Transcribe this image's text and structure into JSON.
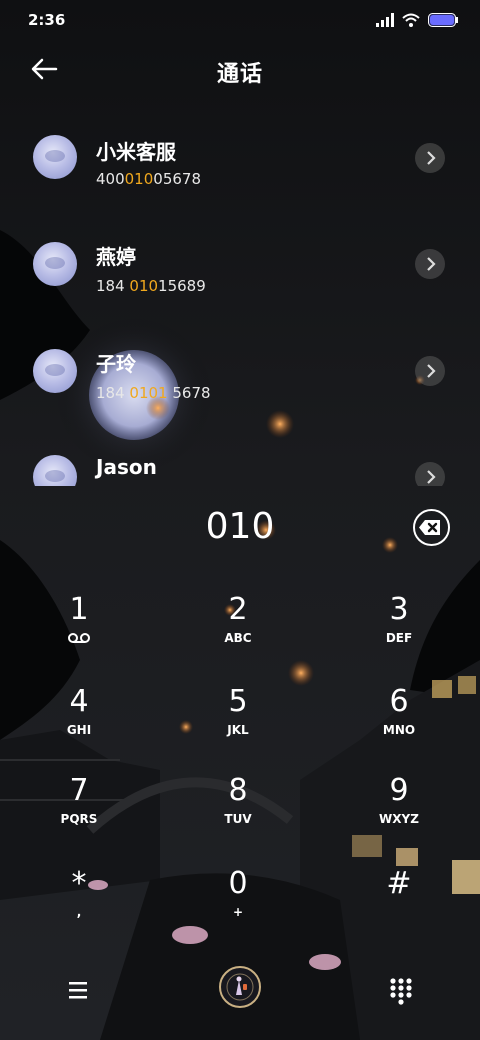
{
  "status_bar": {
    "time": "2:36"
  },
  "header": {
    "title": "通话"
  },
  "contacts": [
    {
      "name": "小米客服",
      "number": {
        "pre": "400",
        "hl": "010",
        "post": "05678"
      }
    },
    {
      "name": "燕婷",
      "number": {
        "pre": "184 ",
        "hl": "010",
        "post": "15689"
      }
    },
    {
      "name": "子玲",
      "number": {
        "pre": "184 ",
        "hl": "0101",
        "post": " 5678"
      }
    },
    {
      "name": "Jason",
      "number": {
        "pre": "",
        "hl": "",
        "post": ""
      }
    }
  ],
  "dialer": {
    "entered": "010",
    "keys": [
      {
        "digit": "1",
        "letters": ""
      },
      {
        "digit": "2",
        "letters": "ABC"
      },
      {
        "digit": "3",
        "letters": "DEF"
      },
      {
        "digit": "4",
        "letters": "GHI"
      },
      {
        "digit": "5",
        "letters": "JKL"
      },
      {
        "digit": "6",
        "letters": "MNO"
      },
      {
        "digit": "7",
        "letters": "PQRS"
      },
      {
        "digit": "8",
        "letters": "TUV"
      },
      {
        "digit": "9",
        "letters": "WXYZ"
      },
      {
        "digit": "*",
        "letters": ","
      },
      {
        "digit": "0",
        "letters": "+"
      },
      {
        "digit": "#",
        "letters": ""
      }
    ]
  },
  "icons": {
    "back": "back-arrow-icon",
    "voicemail": "voicemail-icon",
    "backspace": "backspace-icon",
    "menu": "menu-icon",
    "keypad": "keypad-icon"
  },
  "colors": {
    "highlight": "#f0a81e",
    "battery": "#6a6cff"
  }
}
